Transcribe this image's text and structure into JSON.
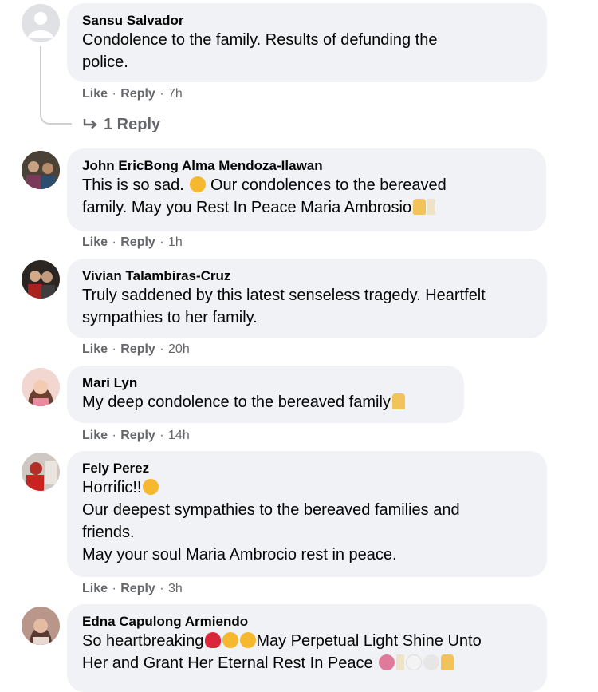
{
  "comments": [
    {
      "author": "Sansu Salvador",
      "lines": [
        "Condolence to the family. Results of defunding the",
        "police."
      ],
      "like": "Like",
      "reply": "Reply",
      "time": "7h",
      "replies_label": "1 Reply"
    },
    {
      "author": "John EricBong Alma Mendoza-Ilawan",
      "lines": [
        "This is so sad.",
        "Our condolences to the bereaved",
        "family. May you Rest In Peace Maria Ambrosio"
      ],
      "like": "Like",
      "reply": "Reply",
      "time": "1h"
    },
    {
      "author": "Vivian Talambiras-Cruz",
      "lines": [
        "Truly saddened by this latest senseless tragedy. Heartfelt",
        "sympathies to her family."
      ],
      "like": "Like",
      "reply": "Reply",
      "time": "20h"
    },
    {
      "author": "Mari Lyn",
      "lines": [
        "My deep condolence to the bereaved family"
      ],
      "like": "Like",
      "reply": "Reply",
      "time": "14h"
    },
    {
      "author": "Fely Perez",
      "lines": [
        "Horrific!!",
        "Our deepest sympathies to the bereaved families and",
        "friends.",
        "May your soul Maria Ambrocio rest in peace."
      ],
      "like": "Like",
      "reply": "Reply",
      "time": "3h"
    },
    {
      "author": "Edna Capulong Armiendo",
      "lines": [
        "So heartbreaking",
        "May Perpetual Light Shine Unto",
        "Her and Grant Her Eternal Rest In Peace"
      ]
    }
  ],
  "icons": {
    "reply_arrow": "reply-arrow-icon",
    "sad_face": "sad-face-emoji",
    "pray": "folded-hands-emoji",
    "broken_heart": "broken-heart-emoji",
    "crying": "crying-face-emoji"
  },
  "colors": {
    "bubble": "#f0f2f5",
    "meta_text": "#65676b",
    "thread_line": "#ced0d4"
  }
}
